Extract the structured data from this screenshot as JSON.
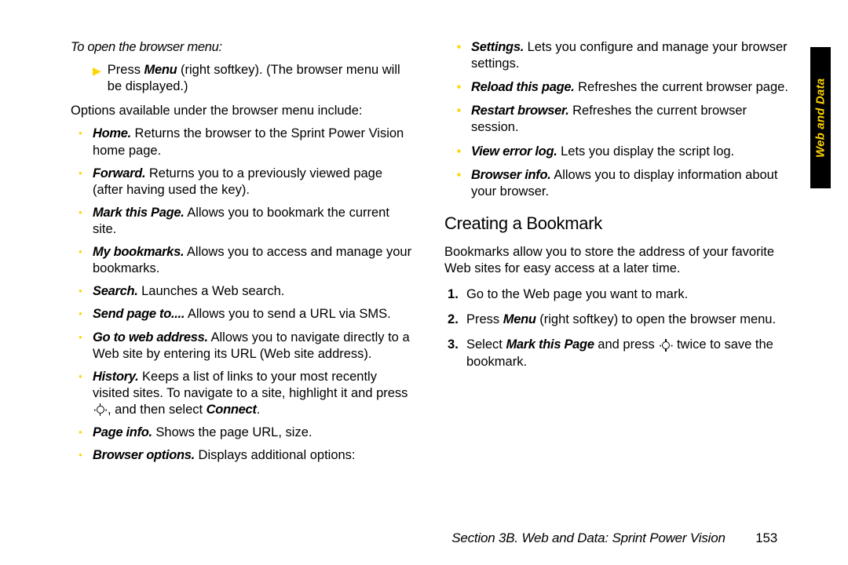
{
  "left": {
    "heading": "To open the browser menu:",
    "step_pre": "Press ",
    "step_b": "Menu",
    "step_post": " (right softkey). (The browser menu will be displayed.)",
    "intro": "Options available under the browser menu include:",
    "items": [
      {
        "t": "Home.",
        "d": " Returns the browser to the Sprint Power Vision home page."
      },
      {
        "t": "Forward.",
        "d": " Returns you to a previously viewed page (after having used the key)."
      },
      {
        "t": "Mark this Page.",
        "d": " Allows you to bookmark the current site."
      },
      {
        "t": "My bookmarks.",
        "d": " Allows you to access and manage your bookmarks."
      },
      {
        "t": "Search.",
        "d": " Launches a Web search."
      },
      {
        "t": "Send page to....",
        "d": " Allows you to send a URL via SMS."
      },
      {
        "t": "Go to web address.",
        "d": " Allows you to navigate directly to a Web site by entering its URL (Web site address)."
      },
      {
        "t": "History.",
        "d1": " Keeps a list of links to your most recently visited sites. To navigate to a site, highlight it and press ",
        "d2": ", and then select ",
        "d3": "Connect",
        "d4": "."
      },
      {
        "t": "Page info.",
        "d": " Shows the page URL, size."
      },
      {
        "t": "Browser options.",
        "d": " Displays additional options:"
      }
    ]
  },
  "right": {
    "sq": [
      {
        "t": "Settings.",
        "d": " Lets you configure and manage your browser settings."
      },
      {
        "t": "Reload this page.",
        "d": " Refreshes the current browser page."
      },
      {
        "t": "Restart browser.",
        "d": " Refreshes the current browser session."
      },
      {
        "t": "View error log.",
        "d": " Lets you display the script log."
      },
      {
        "t": "Browser info.",
        "d": " Allows you to display information about your browser."
      }
    ],
    "h2": "Creating a Bookmark",
    "para": "Bookmarks allow you to store the address of your favorite Web sites for easy access at a later time.",
    "steps": {
      "s1": "Go to the Web page you want to mark.",
      "s2a": "Press ",
      "s2b": "Menu",
      "s2c": " (right softkey) to open the browser menu.",
      "s3a": "Select ",
      "s3b": "Mark this Page",
      "s3c": " and press ",
      "s3d": " twice to save the bookmark."
    }
  },
  "footer": {
    "section": "Section 3B. Web and Data: Sprint Power Vision",
    "page": "153"
  },
  "side_tab": "Web and Data"
}
